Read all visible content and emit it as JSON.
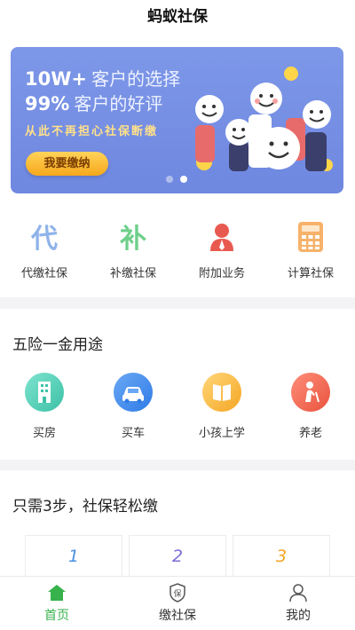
{
  "app": {
    "title": "蚂蚁社保"
  },
  "banner": {
    "line1_big": "10W+",
    "line1_small": "客户的选择",
    "line2_big": "99%",
    "line2_small": "客户的好评",
    "subtitle": "从此不再担心社保断缴",
    "cta": "我要缴纳"
  },
  "services": [
    {
      "label": "代缴社保",
      "glyph": "代",
      "icon": "dai-char-icon"
    },
    {
      "label": "补缴社保",
      "glyph": "补",
      "icon": "bu-char-icon"
    },
    {
      "label": "附加业务",
      "icon": "person-icon"
    },
    {
      "label": "计算社保",
      "icon": "calculator-icon"
    }
  ],
  "uses": {
    "title": "五险一金用途",
    "items": [
      {
        "label": "买房",
        "icon": "building-icon"
      },
      {
        "label": "买车",
        "icon": "car-icon"
      },
      {
        "label": "小孩上学",
        "icon": "book-icon"
      },
      {
        "label": "养老",
        "icon": "elderly-icon"
      }
    ]
  },
  "steps": {
    "title": "只需3步，社保轻松缴",
    "items": [
      "1",
      "2",
      "3"
    ]
  },
  "tabbar": [
    {
      "label": "首页",
      "icon": "home-icon",
      "active": true
    },
    {
      "label": "缴社保",
      "icon": "shield-icon",
      "glyph": "保"
    },
    {
      "label": "我的",
      "icon": "user-icon"
    }
  ],
  "colors": {
    "banner": "#7d97e8",
    "accent_green": "#37b24d",
    "cta": "#f7a81b"
  }
}
